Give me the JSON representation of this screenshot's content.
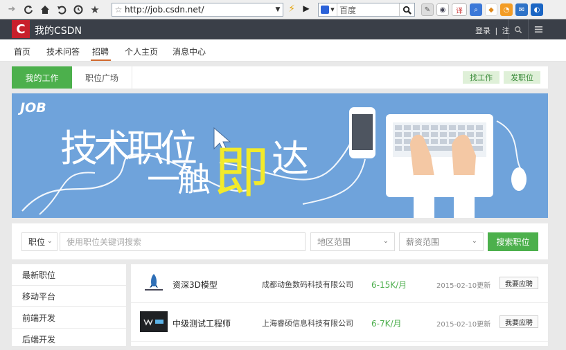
{
  "browser": {
    "url": "http://job.csdn.net/",
    "search_placeholder": "百度"
  },
  "header": {
    "logo_letter": "C",
    "title": "我的CSDN",
    "login_link": "登录",
    "login_separator": "|",
    "register_link": "注"
  },
  "nav": {
    "items": [
      "首页",
      "技术问答",
      "招聘",
      "个人主页",
      "消息中心"
    ],
    "active": "招聘"
  },
  "tabs": {
    "my_jobs": "我的工作",
    "job_square": "职位广场",
    "find_job": "找工作",
    "post_job": "发职位"
  },
  "banner": {
    "brand": "JOB",
    "slogan_part1": "技术职位",
    "slogan_part2": "一触",
    "slogan_highlight": "即",
    "slogan_part3": "达",
    "background_color": "#6fa3db",
    "highlight_color": "#f2ea2a"
  },
  "search": {
    "category_select": "职位",
    "keyword_placeholder": "使用职位关键词搜索",
    "area_select": "地区范围",
    "salary_select": "薪资范围",
    "submit": "搜索职位"
  },
  "sidebar": {
    "items": [
      "最新职位",
      "移动平台",
      "前端开发",
      "后端开发"
    ]
  },
  "jobs": [
    {
      "title": "资深3D模型",
      "company": "成都动鱼数码科技有限公司",
      "salary": "6-15K/月",
      "updated": "2015-02-10更新",
      "apply_label": "我要应聘",
      "logo_icon": "rocket-logo-icon"
    },
    {
      "title": "中级测试工程师",
      "company": "上海睿硕信息科技有限公司",
      "salary": "6-7K/月",
      "updated": "2015-02-10更新",
      "apply_label": "我要应聘",
      "logo_icon": "weimob-logo-icon"
    }
  ],
  "colors": {
    "accent_green": "#4cb04c",
    "header_dark": "#3a3f48",
    "brand_red": "#c8202b",
    "salary_green": "#4cae4c"
  }
}
